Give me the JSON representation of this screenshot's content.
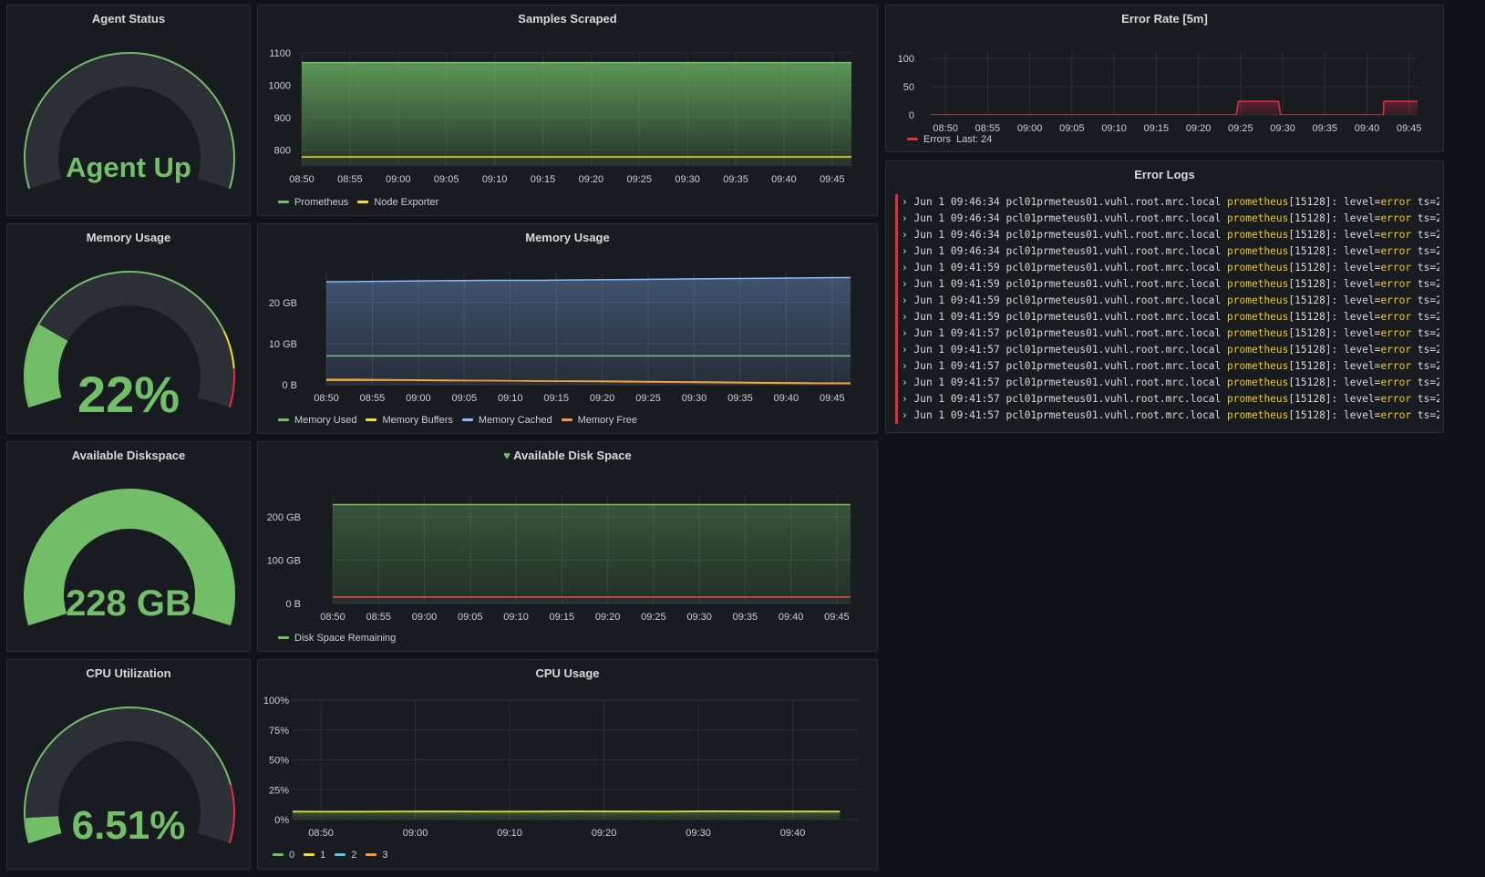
{
  "colors": {
    "green": "#73bf69",
    "yellow": "#fade2a",
    "orange": "#ff9830",
    "blue": "#8ab8ff",
    "red": "#e02f44",
    "cyan": "#5ac8e6",
    "track": "#2c2f36",
    "grid": "#2c3037"
  },
  "gauges": [
    {
      "title": "Agent Status",
      "value_text": "Agent Up",
      "fraction": 0,
      "threshold_bands": [
        {
          "to": 1,
          "color": "#73bf69"
        }
      ]
    },
    {
      "title": "Memory Usage",
      "value_text": "22%",
      "fraction": 0.22,
      "threshold_bands": [
        {
          "to": 0.8,
          "color": "#73bf69"
        },
        {
          "to": 0.9,
          "color": "#fade2a"
        },
        {
          "to": 1,
          "color": "#e02f44"
        }
      ]
    },
    {
      "title": "Available Diskspace",
      "value_text": "228 GB",
      "fraction": 1,
      "threshold_bands": []
    },
    {
      "title": "CPU Utilization",
      "value_text": "6.51%",
      "fraction": 0.0651,
      "threshold_bands": [
        {
          "to": 0.85,
          "color": "#73bf69"
        },
        {
          "to": 1,
          "color": "#e02f44"
        }
      ]
    }
  ],
  "charts": {
    "samples": {
      "title": "Samples Scraped",
      "chart_data": {
        "type": "area",
        "x": [
          "08:50",
          "08:55",
          "09:00",
          "09:05",
          "09:10",
          "09:15",
          "09:20",
          "09:25",
          "09:30",
          "09:35",
          "09:40",
          "09:45"
        ],
        "ylim": [
          750,
          1100
        ],
        "yticks": [
          "800",
          "900",
          "1000",
          "1100"
        ],
        "ytick_values": [
          800,
          900,
          1000,
          1100
        ],
        "xlim": [
          0,
          11.4
        ],
        "series": [
          {
            "name": "Prometheus",
            "color": "#73bf69",
            "fill": true,
            "values": [
              1070,
              1070,
              1070,
              1070,
              1070,
              1070,
              1070,
              1070,
              1070,
              1070,
              1070,
              1070,
              1070
            ]
          },
          {
            "name": "Node Exporter",
            "color": "#fade2a",
            "fill": false,
            "values": [
              778,
              778,
              778,
              778,
              778,
              778,
              778,
              778,
              778,
              778,
              778,
              778,
              778
            ]
          }
        ],
        "series_x": [
          -0.2,
          0.8,
          1.8,
          2.8,
          3.8,
          4.8,
          5.8,
          6.8,
          7.8,
          8.8,
          9.8,
          10.8,
          11.8
        ]
      }
    },
    "memory": {
      "title": "Memory Usage",
      "chart_data": {
        "type": "area",
        "x": [
          "08:50",
          "08:55",
          "09:00",
          "09:05",
          "09:10",
          "09:15",
          "09:20",
          "09:25",
          "09:30",
          "09:35",
          "09:40",
          "09:45"
        ],
        "ylim": [
          0,
          27.5
        ],
        "yticks": [
          "0 B",
          "10 GB",
          "20 GB"
        ],
        "ytick_values": [
          0,
          10,
          20
        ],
        "xlim": [
          0,
          11.4
        ],
        "series": [
          {
            "name": "Memory Used",
            "color": "#73bf69",
            "fill": false,
            "values": [
              7,
              7,
              7,
              7,
              7,
              7,
              7,
              7,
              7,
              7,
              7,
              7,
              7
            ]
          },
          {
            "name": "Memory Buffers",
            "color": "#fade2a",
            "fill": false,
            "values": [
              1.1,
              1.1,
              1.1,
              1.0,
              1.0,
              0.9,
              0.9,
              0.8,
              0.7,
              0.6,
              0.5,
              0.4,
              0.4
            ]
          },
          {
            "name": "Memory Cached",
            "color": "#8ab8ff",
            "fill": true,
            "values": [
              25,
              25.1,
              25.2,
              25.3,
              25.4,
              25.4,
              25.5,
              25.6,
              25.7,
              25.8,
              25.9,
              26,
              26.1
            ]
          },
          {
            "name": "Memory Free",
            "color": "#ff9830",
            "fill": false,
            "values": [
              1.3,
              1.3,
              1.2,
              1.1,
              1.0,
              0.9,
              0.8,
              0.7,
              0.6,
              0.5,
              0.4,
              0.3,
              0.3
            ]
          }
        ],
        "series_x": [
          -0.4,
          0.6,
          1.6,
          2.6,
          3.6,
          4.6,
          5.6,
          6.6,
          7.6,
          8.6,
          9.6,
          10.6,
          11.6
        ]
      }
    },
    "disk": {
      "title": "Available Disk Space",
      "chart_data": {
        "type": "area",
        "x": [
          "08:50",
          "08:55",
          "09:00",
          "09:05",
          "09:10",
          "09:15",
          "09:20",
          "09:25",
          "09:30",
          "09:35",
          "09:40",
          "09:45"
        ],
        "ylim": [
          0,
          250
        ],
        "yticks": [
          "0 B",
          "100 GB",
          "200 GB"
        ],
        "ytick_values": [
          0,
          100,
          200
        ],
        "xlim": [
          0,
          11.3
        ],
        "series": [
          {
            "name": "Disk Space Remaining",
            "color": "#73bf69",
            "fill": true,
            "values": [
              228,
              228,
              228,
              228,
              228,
              228,
              228,
              228,
              228,
              228,
              228,
              228,
              228
            ]
          },
          {
            "name": "",
            "color": "#f2495c",
            "fill": false,
            "values": [
              15,
              15,
              15,
              15,
              15,
              15,
              15,
              15,
              15,
              15,
              15,
              15,
              15
            ]
          }
        ],
        "series_x": [
          -0.6,
          0.4,
          1.4,
          2.4,
          3.4,
          4.4,
          5.4,
          6.4,
          7.4,
          8.4,
          9.4,
          10.4,
          11.3
        ]
      }
    },
    "cpu": {
      "title": "CPU Usage",
      "chart_data": {
        "type": "area",
        "x": [
          "08:50",
          "09:00",
          "09:10",
          "09:20",
          "09:30",
          "09:40"
        ],
        "ylim": [
          0,
          100
        ],
        "yticks": [
          "0%",
          "25%",
          "50%",
          "75%",
          "100%"
        ],
        "ytick_values": [
          0,
          25,
          50,
          75,
          100
        ],
        "xlim": [
          -0.3,
          5.7
        ],
        "series": [
          {
            "name": "0",
            "color": "#73bf69",
            "fill": true,
            "values": [
              6.5,
              6.4,
              6.5,
              6.6,
              6.5,
              6.5,
              6.7,
              6.6,
              6.5,
              6.8,
              6.6,
              6.5
            ]
          },
          {
            "name": "1",
            "color": "#fade2a",
            "fill": false,
            "values": [
              6.8,
              6.7,
              6.8,
              6.9,
              6.8,
              6.8,
              7.0,
              6.9,
              6.8,
              7.1,
              6.9,
              6.8
            ]
          },
          {
            "name": "2",
            "color": "#5ac8e6",
            "fill": false,
            "values": []
          },
          {
            "name": "3",
            "color": "#ff9830",
            "fill": false,
            "values": []
          }
        ],
        "series_x": [
          -0.35,
          0.15,
          0.65,
          1.15,
          1.65,
          2.15,
          2.65,
          3.15,
          3.65,
          4.15,
          4.65,
          5.5
        ]
      }
    },
    "errors": {
      "title": "Error Rate [5m]",
      "legend_last": "Last: 24",
      "chart_data": {
        "type": "line",
        "x": [
          "08:50",
          "08:55",
          "09:00",
          "09:05",
          "09:10",
          "09:15",
          "09:20",
          "09:25",
          "09:30",
          "09:35",
          "09:40",
          "09:45"
        ],
        "ylim": [
          0,
          110
        ],
        "yticks": [
          "0",
          "50",
          "100"
        ],
        "ytick_values": [
          0,
          50,
          100
        ],
        "xlim": [
          -0.35,
          11.2
        ],
        "series": [
          {
            "name": "Errors",
            "color": "#e02f44",
            "fill": true,
            "values": [
              0,
              0,
              0,
              0,
              0,
              0,
              0,
              0,
              0,
              0,
              0,
              0,
              24,
              24,
              24,
              0,
              0,
              0,
              0,
              0,
              0,
              0,
              0,
              0,
              24,
              24
            ]
          },
          {
            "name": "",
            "color": "#e02f44",
            "fill": false,
            "values": []
          }
        ],
        "series_x": [
          -0.7,
          0,
          1,
          2,
          3,
          4,
          5,
          5.9,
          5.9,
          6,
          6.9,
          6.9,
          6.95,
          7,
          7.9,
          7.95,
          8,
          9,
          10,
          10.3,
          10.35,
          10.38,
          10.39,
          10.39,
          10.4,
          11.2
        ]
      }
    }
  },
  "logs": {
    "title": "Error Logs",
    "entries": [
      {
        "date": "Jun  1 09:46:34",
        "host": "pcl01prmeteus01.vuhl.root.mrc.local",
        "proc": "prometheus",
        "pid": "[15128]: level=",
        "level": "error",
        "tail": " ts=2"
      },
      {
        "date": "Jun  1 09:46:34",
        "host": "pcl01prmeteus01.vuhl.root.mrc.local",
        "proc": "prometheus",
        "pid": "[15128]: level=",
        "level": "error",
        "tail": " ts=2"
      },
      {
        "date": "Jun  1 09:46:34",
        "host": "pcl01prmeteus01.vuhl.root.mrc.local",
        "proc": "prometheus",
        "pid": "[15128]: level=",
        "level": "error",
        "tail": " ts=2"
      },
      {
        "date": "Jun  1 09:46:34",
        "host": "pcl01prmeteus01.vuhl.root.mrc.local",
        "proc": "prometheus",
        "pid": "[15128]: level=",
        "level": "error",
        "tail": " ts=2"
      },
      {
        "date": "Jun  1 09:41:59",
        "host": "pcl01prmeteus01.vuhl.root.mrc.local",
        "proc": "prometheus",
        "pid": "[15128]: level=",
        "level": "error",
        "tail": " ts=2"
      },
      {
        "date": "Jun  1 09:41:59",
        "host": "pcl01prmeteus01.vuhl.root.mrc.local",
        "proc": "prometheus",
        "pid": "[15128]: level=",
        "level": "error",
        "tail": " ts=2"
      },
      {
        "date": "Jun  1 09:41:59",
        "host": "pcl01prmeteus01.vuhl.root.mrc.local",
        "proc": "prometheus",
        "pid": "[15128]: level=",
        "level": "error",
        "tail": " ts=2"
      },
      {
        "date": "Jun  1 09:41:59",
        "host": "pcl01prmeteus01.vuhl.root.mrc.local",
        "proc": "prometheus",
        "pid": "[15128]: level=",
        "level": "error",
        "tail": " ts=2"
      },
      {
        "date": "Jun  1 09:41:57",
        "host": "pcl01prmeteus01.vuhl.root.mrc.local",
        "proc": "prometheus",
        "pid": "[15128]: level=",
        "level": "error",
        "tail": " ts=2"
      },
      {
        "date": "Jun  1 09:41:57",
        "host": "pcl01prmeteus01.vuhl.root.mrc.local",
        "proc": "prometheus",
        "pid": "[15128]: level=",
        "level": "error",
        "tail": " ts=2"
      },
      {
        "date": "Jun  1 09:41:57",
        "host": "pcl01prmeteus01.vuhl.root.mrc.local",
        "proc": "prometheus",
        "pid": "[15128]: level=",
        "level": "error",
        "tail": " ts=2"
      },
      {
        "date": "Jun  1 09:41:57",
        "host": "pcl01prmeteus01.vuhl.root.mrc.local",
        "proc": "prometheus",
        "pid": "[15128]: level=",
        "level": "error",
        "tail": " ts=2"
      },
      {
        "date": "Jun  1 09:41:57",
        "host": "pcl01prmeteus01.vuhl.root.mrc.local",
        "proc": "prometheus",
        "pid": "[15128]: level=",
        "level": "error",
        "tail": " ts=2"
      },
      {
        "date": "Jun  1 09:41:57",
        "host": "pcl01prmeteus01.vuhl.root.mrc.local",
        "proc": "prometheus",
        "pid": "[15128]: level=",
        "level": "error",
        "tail": " ts=2"
      }
    ]
  }
}
